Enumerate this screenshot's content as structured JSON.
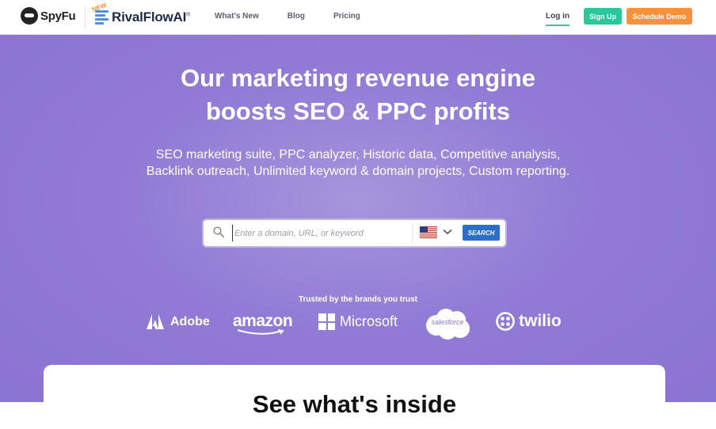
{
  "header": {
    "spyfu_logo": "SpyFu",
    "rival_badge": "NEW",
    "rival_logo": "RivalFlowAI",
    "nav": [
      {
        "label": "What's New"
      },
      {
        "label": "Blog"
      },
      {
        "label": "Pricing"
      }
    ],
    "login_label": "Log in",
    "signup_label": "Sign Up",
    "demo_label": "Schedule Demo"
  },
  "hero": {
    "title_line1": "Our marketing revenue engine",
    "title_line2": "boosts SEO & PPC profits",
    "subtitle": "SEO marketing suite, PPC analyzer, Historic data, Competitive analysis, Backlink outreach, Unlimited keyword & domain projects, Custom reporting.",
    "search": {
      "placeholder": "Enter a domain, URL, or keyword",
      "value": "",
      "country_icon": "us-flag-icon",
      "button_label": "SEARCH"
    },
    "trusted_label": "Trusted by the brands you trust",
    "brands": [
      {
        "name": "Adobe"
      },
      {
        "name": "amazon"
      },
      {
        "name": "Microsoft"
      },
      {
        "name": "salesforce"
      },
      {
        "name": "twilio"
      }
    ]
  },
  "card": {
    "title": "See what's inside"
  },
  "colors": {
    "hero_bg": "#917bd6",
    "signup": "#2bc79a",
    "demo": "#f8923a",
    "search_button": "#2d6fc6"
  }
}
